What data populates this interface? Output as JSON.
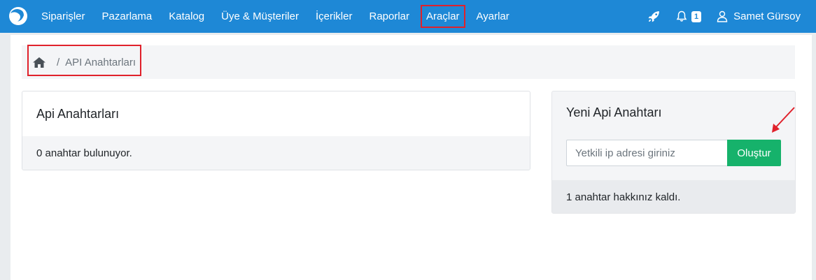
{
  "topbar": {
    "nav": [
      {
        "label": "Siparişler"
      },
      {
        "label": "Pazarlama"
      },
      {
        "label": "Katalog"
      },
      {
        "label": "Üye & Müşteriler"
      },
      {
        "label": "İçerikler"
      },
      {
        "label": "Raporlar"
      },
      {
        "label": "Araçlar",
        "highlighted": true
      },
      {
        "label": "Ayarlar"
      }
    ],
    "notification_count": "1",
    "user_name": "Samet Gürsoy",
    "icons": [
      "logo-icon",
      "rocket-icon",
      "bell-icon",
      "user-icon"
    ],
    "highlight_color": "#e0212b",
    "bar_color": "#1e88d6"
  },
  "breadcrumb": {
    "icon": "home-icon",
    "separator": "/",
    "current": "API Anahtarları"
  },
  "left_card": {
    "title": "Api Anahtarları",
    "body": "0 anahtar bulunuyor."
  },
  "right_card": {
    "title": "Yeni Api Anahtarı",
    "input_placeholder": "Yetkili ip adresi giriniz",
    "input_value": "",
    "button_label": "Oluştur",
    "button_color": "#16b26b",
    "footer": "1 anahtar hakkınız kaldı."
  }
}
